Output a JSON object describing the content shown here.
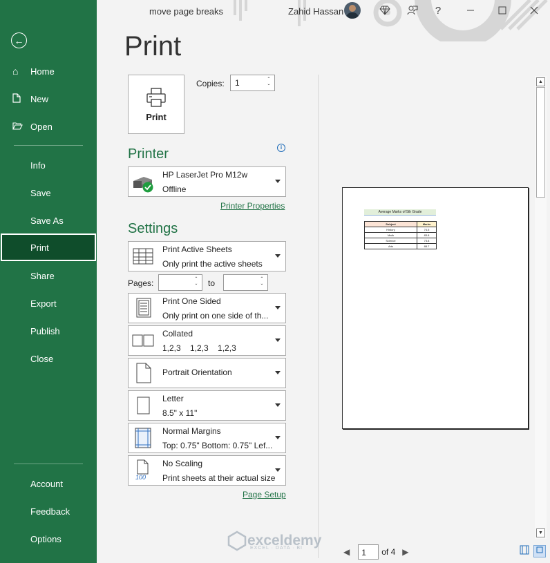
{
  "window": {
    "title": "move page breaks",
    "user": "Zahid Hassan",
    "help": "?"
  },
  "sidebar": {
    "items": [
      {
        "label": "Home",
        "icon": "home-icon"
      },
      {
        "label": "New",
        "icon": "new-file-icon"
      },
      {
        "label": "Open",
        "icon": "folder-open-icon"
      },
      {
        "label": "Info"
      },
      {
        "label": "Save"
      },
      {
        "label": "Save As"
      },
      {
        "label": "Print",
        "active": true
      },
      {
        "label": "Share"
      },
      {
        "label": "Export"
      },
      {
        "label": "Publish"
      },
      {
        "label": "Close"
      },
      {
        "label": "Account"
      },
      {
        "label": "Feedback"
      },
      {
        "label": "Options"
      }
    ]
  },
  "print": {
    "title": "Print",
    "button_label": "Print",
    "copies_label": "Copies:",
    "copies_value": "1"
  },
  "printer": {
    "section_title": "Printer",
    "name": "HP LaserJet Pro M12w",
    "status": "Offline",
    "properties_link": "Printer Properties"
  },
  "settings": {
    "section_title": "Settings",
    "what": {
      "line1": "Print Active Sheets",
      "line2": "Only print the active sheets"
    },
    "pages_label": "Pages:",
    "to_label": "to",
    "pages_from": "",
    "pages_to": "",
    "sides": {
      "line1": "Print One Sided",
      "line2": "Only print on one side of th..."
    },
    "collation": {
      "line1": "Collated",
      "line2": "1,2,3    1,2,3    1,2,3"
    },
    "orientation": {
      "line1": "Portrait Orientation"
    },
    "paper": {
      "line1": "Letter",
      "line2": "8.5\" x 11\""
    },
    "margins": {
      "line1": "Normal Margins",
      "line2": "Top: 0.75\" Bottom: 0.75\" Lef..."
    },
    "scaling": {
      "line1": "No Scaling",
      "line2": "Print sheets at their actual size",
      "icon_text": "100"
    },
    "page_setup_link": "Page Setup"
  },
  "preview": {
    "sheet_title": "Average Marks of 5th Grade",
    "table_header": [
      "Subject",
      "Marks"
    ],
    "rows": [
      [
        "History",
        "74.5"
      ],
      [
        "Math",
        "83.8"
      ],
      [
        "Science",
        "73.8"
      ],
      [
        "Arts",
        "88.7"
      ]
    ],
    "current_page": "1",
    "of_pages": "of 4"
  },
  "watermark": {
    "name": "exceldemy",
    "tagline": "EXCEL · DATA · BI"
  },
  "colors": {
    "accent": "#217346",
    "active_nav": "#0f4d2b"
  }
}
